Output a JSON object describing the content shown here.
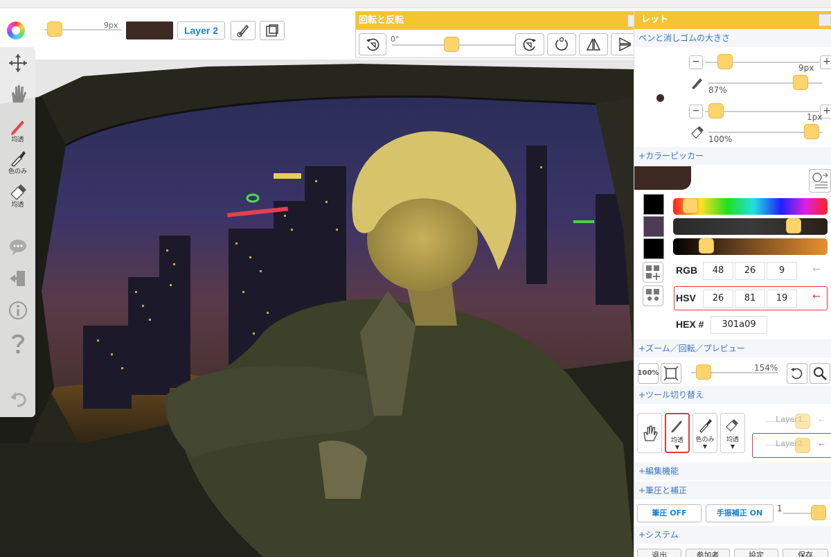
{
  "topbar": {
    "brush_size": "9px",
    "current_color": "#3d2a22",
    "layer_button": "Layer 2"
  },
  "rotate_panel": {
    "title": "回転と反転",
    "angle": "0°"
  },
  "left_toolbar": {
    "pen_label": "均透",
    "eyedropper_label": "色のみ",
    "eraser_label": "均透"
  },
  "palette": {
    "title": "レット",
    "pen_eraser_section": "ペンと消しゴムの大きさ",
    "pen": {
      "size": "9px",
      "opacity": "87%"
    },
    "eraser": {
      "size": "1px",
      "opacity": "100%"
    },
    "colorpicker_section": "+カラーピッカー",
    "main_color": "#3d2a22",
    "swatches": [
      "#000000",
      "#4d3a55",
      "#000000"
    ],
    "rgb": {
      "label": "RGB",
      "r": "48",
      "g": "26",
      "b": "9"
    },
    "hsv": {
      "label": "HSV",
      "h": "26",
      "s": "81",
      "v": "19"
    },
    "hex": {
      "label": "HEX #",
      "value": "301a09"
    },
    "zoom_section": "+ズーム／回転／プレビュー",
    "zoom": {
      "reset_label": "100%",
      "value": "154%"
    },
    "tool_switch_section": "+ツール切り替え",
    "tools": [
      {
        "label": "均透"
      },
      {
        "label": "色のみ"
      },
      {
        "label": "均透"
      }
    ],
    "layers": [
      {
        "label": "Layer1"
      },
      {
        "label": "Layer2"
      }
    ],
    "edit_section": "+編集機能",
    "pressure_section": "+筆圧と補正",
    "pressure_button": "筆圧 OFF",
    "stabilizer_button": "手振補正 ON",
    "stabilizer_value": "1",
    "system_section": "+システム",
    "system_buttons": [
      "退出",
      "参加者",
      "設定",
      "保存"
    ]
  }
}
